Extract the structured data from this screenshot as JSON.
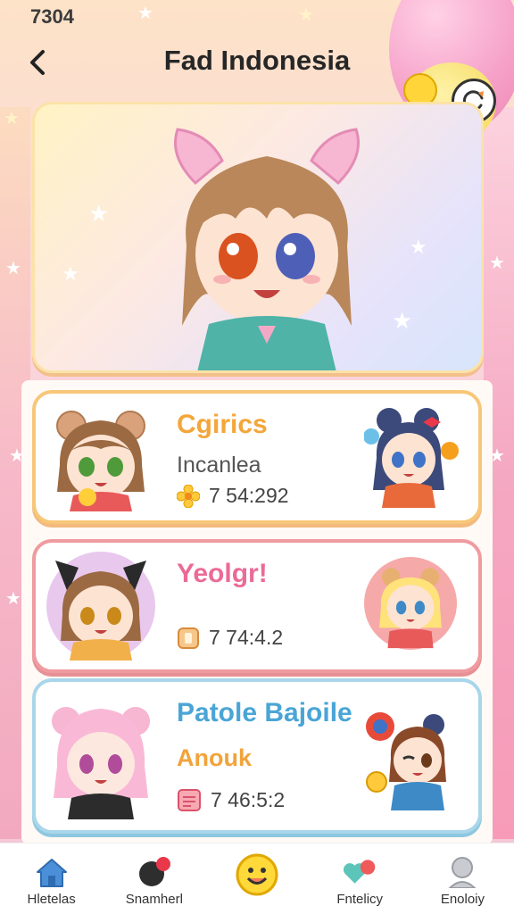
{
  "status_bar": {
    "time": "7304"
  },
  "header": {
    "title": "Fad Indonesia"
  },
  "cards": [
    {
      "title": "Cgirics",
      "subtitle": "Incanlea",
      "meta": "7 54:292",
      "title_color": "#f3a63a",
      "meta_icon": "flower-icon"
    },
    {
      "title": "Yeolgr!",
      "subtitle": "",
      "meta": "7 74:4.2",
      "title_color": "#ec6a97",
      "meta_icon": "tag-icon"
    },
    {
      "title": "Patole Bajoile",
      "subtitle": "Anouk",
      "meta": "7 46:5:2",
      "title_color": "#4aa5d6",
      "subtitle_color": "#f2a33a",
      "meta_icon": "calendar-icon"
    }
  ],
  "tabs": [
    {
      "label": "Hletelas",
      "icon": "home-icon"
    },
    {
      "label": "Snamherl",
      "icon": "balloon-icon"
    },
    {
      "label": "",
      "icon": "smiley-icon"
    },
    {
      "label": "Fntelicy",
      "icon": "hearts-icon"
    },
    {
      "label": "Enoloiy",
      "icon": "profile-icon"
    }
  ],
  "colors": {
    "accent": "#f3a63a",
    "pink": "#ec6a97",
    "blue": "#4aa5d6"
  }
}
